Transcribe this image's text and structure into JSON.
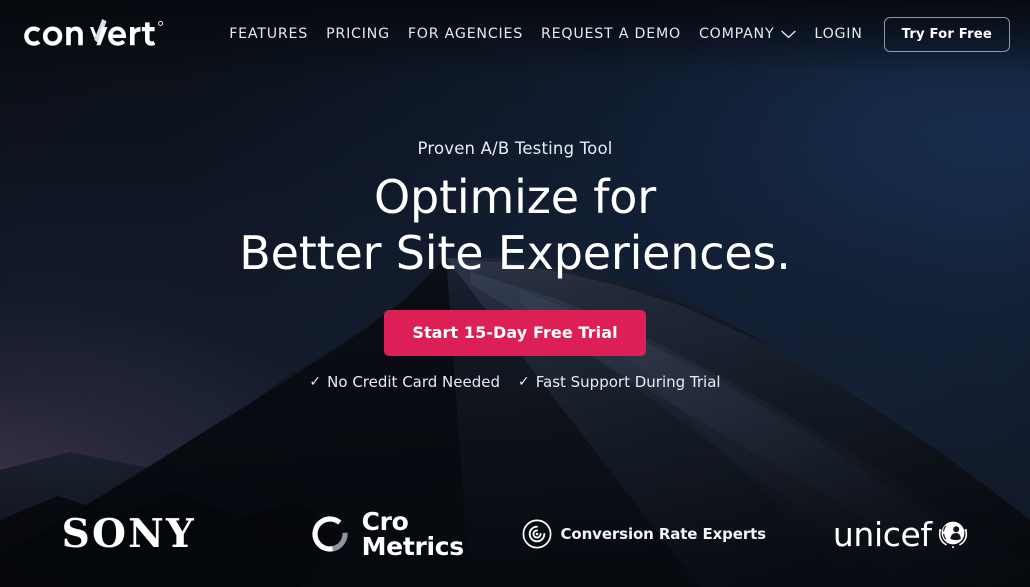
{
  "brand": {
    "logo_text": "convert",
    "logo_registered_mark": "®"
  },
  "nav": {
    "items": [
      {
        "label": "FEATURES",
        "has_dropdown": false
      },
      {
        "label": "PRICING",
        "has_dropdown": false
      },
      {
        "label": "FOR AGENCIES",
        "has_dropdown": false
      },
      {
        "label": "REQUEST A DEMO",
        "has_dropdown": false
      },
      {
        "label": "COMPANY",
        "has_dropdown": true
      },
      {
        "label": "LOGIN",
        "has_dropdown": false
      }
    ],
    "cta_button": "Try For Free"
  },
  "hero": {
    "eyebrow": "Proven A/B Testing Tool",
    "headline_line1": "Optimize for",
    "headline_line2": "Better Site Experiences.",
    "cta_label": "Start 15-Day Free Trial",
    "cta_color": "#DC2056",
    "trust": [
      {
        "tick": "✓",
        "label": "No Credit Card Needed"
      },
      {
        "tick": "✓",
        "label": "Fast Support During Trial"
      }
    ]
  },
  "clients": [
    {
      "name": "SONY",
      "text": "SONY"
    },
    {
      "name": "Cro Metrics",
      "line1": "Cro",
      "line2": "Metrics"
    },
    {
      "name": "Conversion Rate Experts",
      "text": "Conversion Rate Experts"
    },
    {
      "name": "unicef",
      "text": "unicef"
    }
  ],
  "theme": {
    "background_top": "#0A0E16",
    "background_bottom": "#151F31",
    "text_primary": "#FFFFFF",
    "accent": "#DC2056"
  }
}
